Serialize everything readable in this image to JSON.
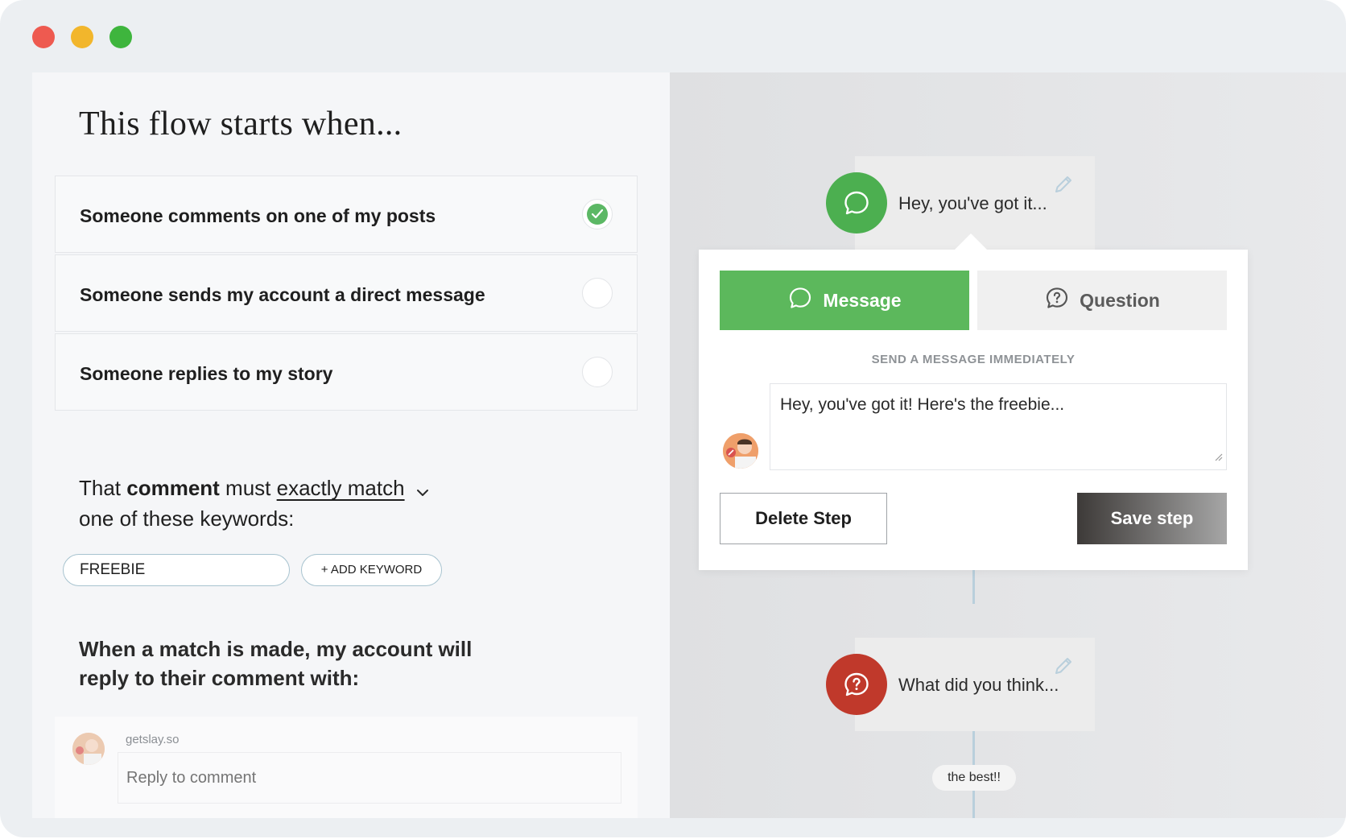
{
  "window": {
    "controls": [
      "close",
      "minimize",
      "maximize"
    ]
  },
  "left": {
    "title": "This flow starts when...",
    "options": [
      {
        "label": "Someone comments on one of my posts",
        "checked": true
      },
      {
        "label": "Someone sends my account a direct message",
        "checked": false
      },
      {
        "label": "Someone replies to my story",
        "checked": false
      }
    ],
    "keyword_rule": {
      "prefix": "That ",
      "subject": "comment",
      "verb": " must ",
      "match_type": "exactly match",
      "suffix": "one of these keywords:"
    },
    "keywords": [
      "FREEBIE"
    ],
    "add_keyword_label": "+ ADD KEYWORD",
    "reply_heading_line1": "When a match is made, my account will",
    "reply_heading_line2": "reply to their comment with:",
    "reply": {
      "username": "getslay.so",
      "placeholder": "Reply to comment"
    }
  },
  "flow": {
    "nodes": [
      {
        "text": "Hey, you've got it...",
        "type": "message",
        "color": "#4caf50"
      },
      {
        "text": "What did you think...",
        "type": "question",
        "color": "#c0392b"
      }
    ],
    "edge_label": "the best!!"
  },
  "editor": {
    "tabs": [
      {
        "label": "Message",
        "icon": "chat-bubble-icon",
        "active": true
      },
      {
        "label": "Question",
        "icon": "question-bubble-icon",
        "active": false
      }
    ],
    "caption": "SEND A MESSAGE IMMEDIATELY",
    "message_value": "Hey, you've got it! Here's the freebie...",
    "delete_label": "Delete Step",
    "save_label": "Save step"
  },
  "colors": {
    "accent_green": "#5cb85c",
    "question_red": "#c0392b"
  }
}
